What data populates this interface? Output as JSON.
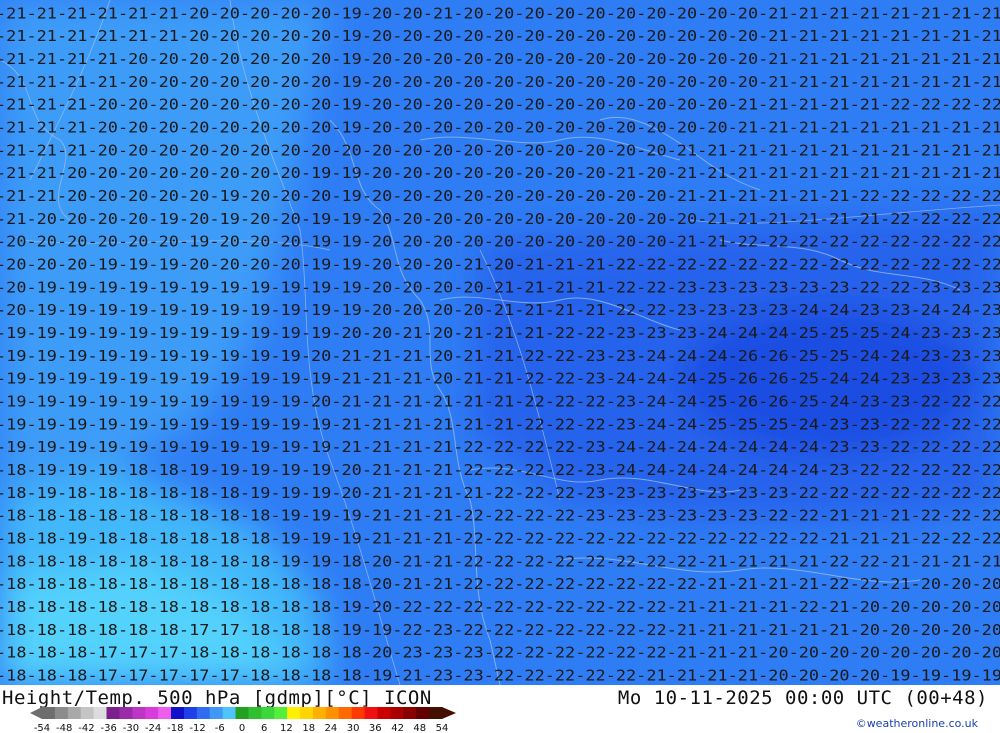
{
  "title_left": "Height/Temp. 500 hPa [gdmp][°C] ICON",
  "title_right": "Mo 10-11-2025 00:00 UTC (00+48)",
  "credit": "©weatheronline.co.uk",
  "colorbar": {
    "ticks": [
      "-54",
      "-48",
      "-42",
      "-36",
      "-30",
      "-24",
      "-18",
      "-12",
      "-6",
      "0",
      "6",
      "12",
      "18",
      "24",
      "30",
      "36",
      "42",
      "48",
      "54"
    ],
    "colors": [
      "#6e6e6e",
      "#8c8c8c",
      "#a8a8a8",
      "#c4c4c4",
      "#dcdcdc",
      "#7a1f8c",
      "#9b2aa8",
      "#bb36c4",
      "#d83cdc",
      "#ee5cf0",
      "#1010c8",
      "#1f3fe8",
      "#2f6cf2",
      "#3f98f6",
      "#4fc4fa",
      "#22a022",
      "#2fbf2f",
      "#3ad83a",
      "#55ee3a",
      "#fff000",
      "#ffd400",
      "#ffb000",
      "#ff9000",
      "#ff6a00",
      "#ff3a00",
      "#f01010",
      "#cc0000",
      "#aa0000",
      "#880000",
      "#660000",
      "#441100"
    ]
  },
  "contour_rows": [
    "-21-21-21-21-21-21-20-20-20-20-20-19-20-20-21-20-20-20-20-20-20-20-20-20-20-21-21-21-21-21-21-21-21",
    "-21-21-21-21-21-21-20-20-20-20-20-19-20-20-20-20-20-20-20-20-20-20-20-20-20-21-21-21-21-21-21-21-21",
    "-21-21-21-21-20-20-20-20-20-20-20-19-20-20-20-20-20-20-20-20-20-20-20-20-20-21-21-21-21-21-21-21-21",
    "-21-21-21-21-20-20-20-20-20-20-20-19-20-20-20-20-20-20-20-20-20-20-20-20-20-21-21-21-21-21-21-21-21",
    "-21-21-21-20-20-20-20-20-20-20-20-19-20-20-20-20-20-20-20-20-20-20-20-20-21-21-21-21-21-22-22-22-22",
    "-21-21-21-20-20-20-20-20-20-20-20-19-20-20-20-20-20-20-20-20-20-20-20-20-21-21-21-21-21-21-21-21-21",
    "-21-21-21-20-20-20-20-20-20-20-20-20-20-20-20-20-20-20-20-20-20-20-21-21-21-21-21-21-21-21-21-21-21",
    "-21-21-20-20-20-20-20-20-20-20-19-19-20-20-20-20-20-20-20-20-21-20-21-21-21-21-21-21-21-21-21-21-21",
    "-21-21-20-20-20-20-20-19-20-20-20-19-20-20-20-20-20-20-20-20-20-20-21-21-21-21-21-21-22-22-22-22-22",
    "-21-20-20-20-20-19-20-19-20-20-19-19-20-20-20-20-20-20-20-20-20-20-20-21-21-21-21-21-21-22-22-22-22",
    "-20-20-20-20-20-20-19-20-20-20-19-19-20-20-20-20-20-20-20-20-20-20-21-21-22-22-22-22-22-22-22-22-22",
    "-20-20-20-19-19-19-20-20-20-20-19-19-20-20-20-21-20-21-21-21-22-22-22-22-22-22-22-22-22-22-22-22-22",
    "-20-19-19-19-19-19-19-19-19-19-19-19-20-20-20-20-21-21-21-21-22-22-23-23-23-23-23-23-22-22-23-23-23",
    "-20-19-19-19-19-19-19-19-19-19-19-19-20-20-20-20-21-21-21-21-22-22-23-23-23-23-24-24-23-23-24-24-23",
    "-19-19-19-19-19-19-19-19-19-19-19-20-20-21-20-21-21-21-22-22-23-23-23-24-24-24-25-25-25-24-23-23-23",
    "-19-19-19-19-19-19-19-19-19-19-20-21-21-21-20-21-21-22-22-23-23-24-24-24-26-26-25-25-24-24-23-23-23",
    "-19-19-19-19-19-19-19-19-19-19-19-21-21-21-20-21-21-22-22-23-24-24-24-25-26-26-25-24-24-23-23-23-23",
    "-19-19-19-19-19-19-19-19-19-19-20-21-21-21-21-21-21-22-22-22-23-24-24-25-26-26-25-24-23-23-22-22-22",
    "-19-19-19-19-19-19-19-19-19-19-19-21-21-21-21-21-21-22-22-22-23-24-24-25-25-25-24-23-23-22-22-22-22",
    "-19-19-19-19-19-19-19-19-19-19-19-21-21-21-21-22-22-22-22-23-24-24-24-24-24-24-24-23-23-22-22-22-22",
    "-18-19-19-19-18-18-19-19-19-19-19-20-21-21-21-22-22-22-22-23-24-24-24-24-24-24-24-23-22-22-22-22-22",
    "-18-19-18-18-18-18-18-18-19-19-19-20-21-21-21-21-22-22-22-23-23-23-23-23-23-23-22-22-22-22-22-22-22",
    "-18-18-18-18-18-18-18-18-18-19-19-19-21-21-21-22-22-22-22-23-23-23-23-23-23-22-22-21-21-21-22-22-22",
    "-18-18-19-18-18-18-18-18-18-19-19-19-21-21-21-22-22-22-22-22-22-22-22-22-22-22-22-21-21-21-22-22-22",
    "-18-18-18-18-18-18-18-18-18-19-19-18-20-21-21-22-22-22-22-22-22-22-22-21-21-21-21-22-22-21-21-21-21",
    "-18-18-18-18-18-18-18-18-18-18-18-18-20-21-21-22-22-22-22-22-22-22-22-21-21-21-21-22-22-21-20-20-20",
    "-18-18-18-18-18-18-18-18-18-18-18-19-20-22-22-22-22-22-22-22-22-22-21-21-21-21-22-21-20-20-20-20-20",
    "-18-18-18-18-18-18-17-17-18-18-18-19-19-22-23-22-22-22-22-22-22-22-21-21-21-21-21-21-20-20-20-20-20",
    "-18-18-18-17-17-17-18-18-18-18-18-18-20-23-23-23-22-22-22-22-22-22-21-21-21-20-20-20-20-20-20-20-20",
    "-18-18-18-17-17-17-17-17-18-18-18-18-19-21-23-23-22-22-22-22-22-21-21-21-21-20-20-20-20-19-19-19-19"
  ]
}
